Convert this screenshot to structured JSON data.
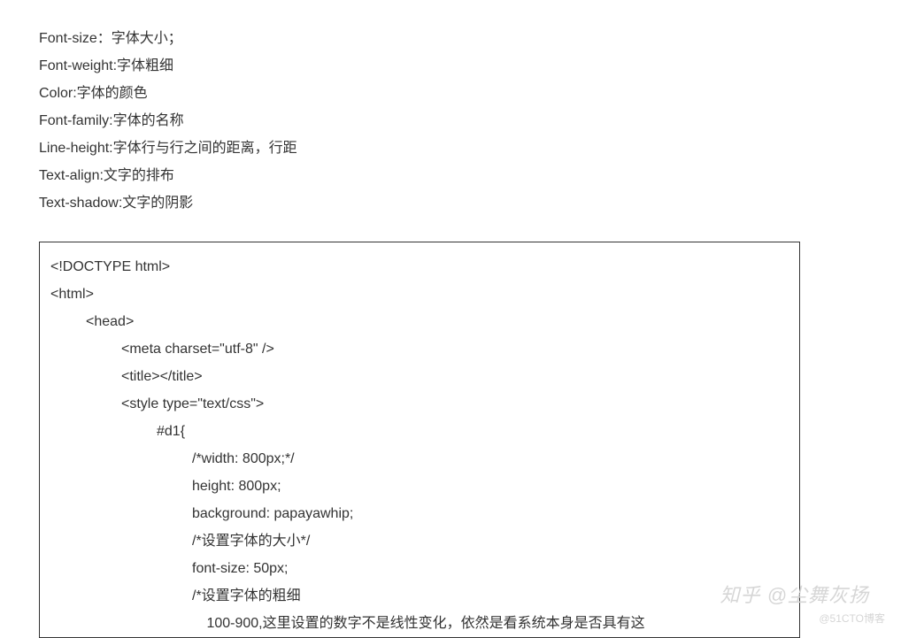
{
  "definitions": [
    "Font-size：字体大小；",
    "Font-weight:字体粗细",
    "Color:字体的颜色",
    "Font-family:字体的名称",
    "Line-height:字体行与行之间的距离，行距",
    "Text-align:文字的排布",
    "Text-shadow:文字的阴影"
  ],
  "code": {
    "l0": "<!DOCTYPE html>",
    "l1": "<html>",
    "l2": "<head>",
    "l3": "<meta charset=\"utf-8\" />",
    "l4": "<title></title>",
    "l5": "<style type=\"text/css\">",
    "l6": "#d1{",
    "l7": "/*width: 800px;*/",
    "l8": "height: 800px;",
    "l9": "background: papayawhip;",
    "l10": "/*设置字体的大小*/",
    "l11": "font-size: 50px;",
    "l12": "/*设置字体的粗细",
    "l13": " 100-900,这里设置的数字不是线性变化，依然是看系统本身是否具有这"
  },
  "watermark": {
    "main": "知乎 @尘舞灰扬",
    "sub": "@51CTO博客"
  }
}
